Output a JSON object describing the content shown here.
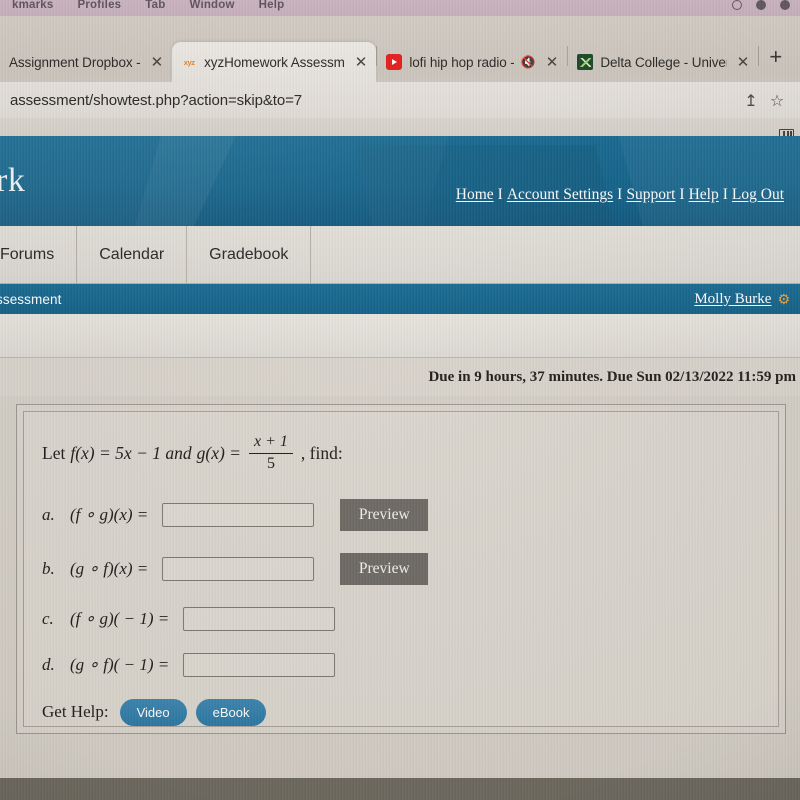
{
  "os_menubar": {
    "items": [
      "kmarks",
      "Profiles",
      "Tab",
      "Window",
      "Help"
    ],
    "status_icons": [
      "clock-icon",
      "moon-icon",
      "battery-icon"
    ]
  },
  "browser": {
    "tabs": [
      {
        "title": "Assignment Dropbox - ",
        "favicon": "generic-icon",
        "favicon_class": "none",
        "active": false,
        "close_label": "✕",
        "muted": false
      },
      {
        "title": "xyzHomework Assessm",
        "favicon": "xyz-icon",
        "favicon_class": "xyz",
        "favicon_text": "xyz",
        "active": true,
        "close_label": "✕",
        "muted": false
      },
      {
        "title": "lofi hip hop radio - ",
        "favicon": "youtube-icon",
        "favicon_class": "yt",
        "active": false,
        "close_label": "✕",
        "muted": true,
        "mute_glyph": "🔇"
      },
      {
        "title": "Delta College - Univers",
        "favicon": "delta-college-icon",
        "favicon_class": "delta",
        "active": false,
        "close_label": "✕",
        "muted": false
      }
    ],
    "new_tab_label": "+",
    "url": "assessment/showtest.php?action=skip&to=7",
    "toolbar_icons": {
      "share": "↥",
      "bookmark": "☆"
    },
    "reading_list_icon": "reading-list-icon"
  },
  "site": {
    "logo_text": "rk",
    "banner_color": "#16658c",
    "links": [
      {
        "label": "Home"
      },
      {
        "label": "Account Settings"
      },
      {
        "label": "Support"
      },
      {
        "label": "Help"
      },
      {
        "label": "Log Out"
      }
    ],
    "link_separator": "I",
    "nav_tabs": [
      {
        "label": "Forums"
      },
      {
        "label": "Calendar"
      },
      {
        "label": "Gradebook"
      }
    ],
    "breadcrumb": "ssessment",
    "user_name": "Molly Burke",
    "gear_icon": "⚙",
    "gear_color": "#f2a33c"
  },
  "assessment": {
    "due_text": "Due in 9 hours, 37 minutes. Due Sun 02/13/2022 11:59 pm",
    "statement": {
      "prefix": "Let",
      "f_def": "f(x) = 5x − 1 and",
      "g_label": "g(x) =",
      "fraction_numerator": "x + 1",
      "fraction_denominator": "5",
      "suffix": ", find:"
    },
    "questions": [
      {
        "label": "a.",
        "expression": "(f ∘ g)(x) =",
        "answer_value": "",
        "answer_placeholder": "",
        "has_preview": true,
        "preview_label": "Preview"
      },
      {
        "label": "b.",
        "expression": "(g ∘ f)(x) =",
        "answer_value": "",
        "answer_placeholder": "",
        "has_preview": true,
        "preview_label": "Preview"
      },
      {
        "label": "c.",
        "expression": "(f ∘ g)( − 1) =",
        "answer_value": "",
        "answer_placeholder": "",
        "has_preview": false,
        "preview_label": ""
      },
      {
        "label": "d.",
        "expression": "(g ∘ f)( − 1) =",
        "answer_value": "",
        "answer_placeholder": "",
        "has_preview": false,
        "preview_label": ""
      }
    ],
    "get_help": {
      "label": "Get Help:",
      "buttons": [
        {
          "label": "Video"
        },
        {
          "label": "eBook"
        }
      ]
    }
  }
}
